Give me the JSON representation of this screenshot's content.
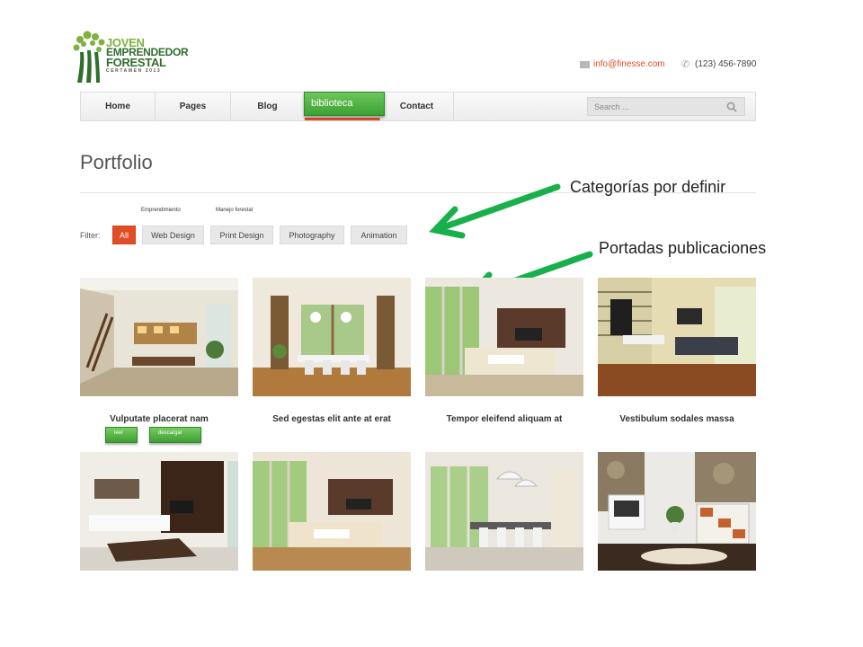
{
  "logo": {
    "line1": "JOVEN",
    "line2": "EMPRENDEDOR",
    "line3": "FORESTAL",
    "line4": "CERTAMEN 2013"
  },
  "contact": {
    "email": "info@finesse.com",
    "phone": "(123) 456-7890"
  },
  "nav": {
    "items": [
      {
        "label": "Home"
      },
      {
        "label": "Pages"
      },
      {
        "label": "Blog"
      },
      {
        "label": ""
      },
      {
        "label": "Contact"
      }
    ],
    "overlay_button": "biblioteca",
    "search_placeholder": "Search ..."
  },
  "page": {
    "title": "Portfolio"
  },
  "categories": [
    "Emprendimiento",
    "Manejo forestal"
  ],
  "filter": {
    "label": "Filter:",
    "buttons": [
      "All",
      "Web Design",
      "Print Design",
      "Photography",
      "Animation"
    ],
    "active": "All"
  },
  "annotations": {
    "categories": "Categorías por definir",
    "covers": "Portadas publicaciones"
  },
  "portfolio": {
    "captions": [
      "Vulputate placerat nam",
      "Sed egestas elit ante at erat",
      "Tempor eleifend aliquam at",
      "Vestibulum sodales massa"
    ],
    "buttons": [
      "leer",
      "descargar"
    ]
  },
  "colors": {
    "accent": "#e14d27",
    "brand_green": "#3aa233",
    "annotation_arrow": "#17b04a"
  }
}
